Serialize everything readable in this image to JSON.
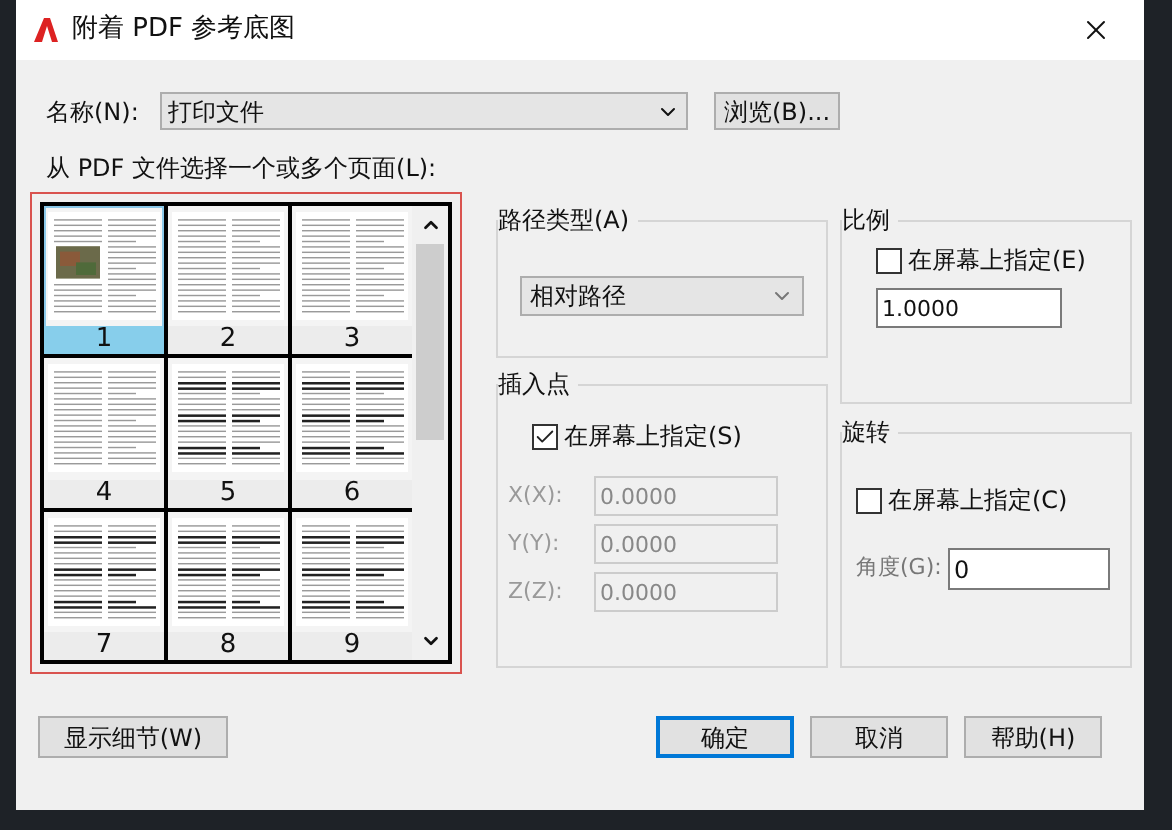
{
  "window": {
    "title": "附着 PDF 参考底图"
  },
  "name": {
    "label": "名称(N):",
    "value": "打印文件"
  },
  "browse_button": {
    "label": "浏览(B)..."
  },
  "pages": {
    "label": "从 PDF 文件选择一个或多个页面(L):",
    "items": [
      {
        "label": "1",
        "selected": true,
        "kind": "image"
      },
      {
        "label": "2",
        "selected": false,
        "kind": "text"
      },
      {
        "label": "3",
        "selected": false,
        "kind": "text"
      },
      {
        "label": "4",
        "selected": false,
        "kind": "text"
      },
      {
        "label": "5",
        "selected": false,
        "kind": "table"
      },
      {
        "label": "6",
        "selected": false,
        "kind": "table"
      },
      {
        "label": "7",
        "selected": false,
        "kind": "table"
      },
      {
        "label": "8",
        "selected": false,
        "kind": "table"
      },
      {
        "label": "9",
        "selected": false,
        "kind": "table"
      }
    ]
  },
  "path_type": {
    "label": "路径类型(A)",
    "value": "相对路径"
  },
  "insertion_point": {
    "label": "插入点",
    "specify": {
      "label": "在屏幕上指定(S)",
      "checked": true
    },
    "fields": [
      {
        "label": "X(X):",
        "value": "0.0000",
        "disabled": true
      },
      {
        "label": "Y(Y):",
        "value": "0.0000",
        "disabled": true
      },
      {
        "label": "Z(Z):",
        "value": "0.0000",
        "disabled": true
      }
    ]
  },
  "scale": {
    "label": "比例",
    "specify": {
      "label": "在屏幕上指定(E)",
      "checked": false
    },
    "value": "1.0000"
  },
  "rotation": {
    "label": "旋转",
    "specify": {
      "label": "在屏幕上指定(C)",
      "checked": false
    },
    "angle": {
      "label": "角度(G):",
      "value": "0"
    }
  },
  "details_button": {
    "label": "显示细节(W)"
  },
  "buttons": [
    {
      "label": "确定",
      "default": true
    },
    {
      "label": "取消",
      "default": false
    },
    {
      "label": "帮助(H)",
      "default": false
    }
  ]
}
